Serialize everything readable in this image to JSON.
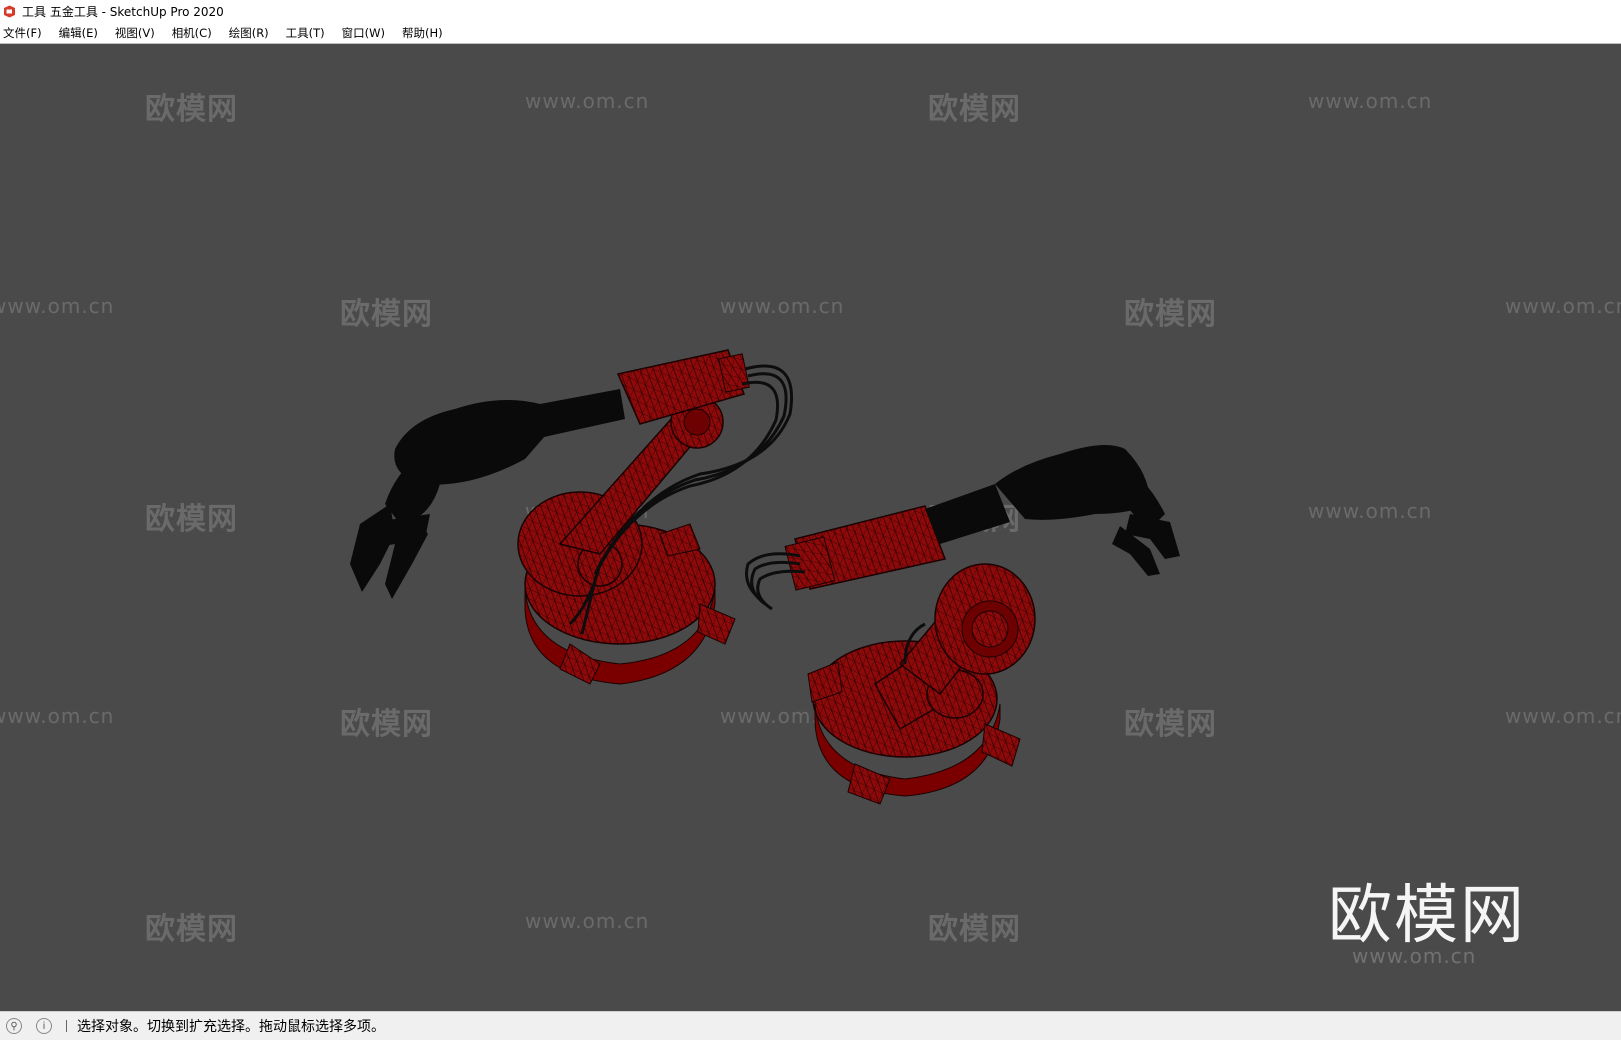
{
  "window": {
    "title": "工具 五金工具 - SketchUp Pro 2020",
    "icon": "sketchup-icon"
  },
  "menubar": {
    "items": [
      {
        "label": "文件(F)"
      },
      {
        "label": "编辑(E)"
      },
      {
        "label": "视图(V)"
      },
      {
        "label": "相机(C)"
      },
      {
        "label": "绘图(R)"
      },
      {
        "label": "工具(T)"
      },
      {
        "label": "窗口(W)"
      },
      {
        "label": "帮助(H)"
      }
    ]
  },
  "viewport": {
    "background": "#4a4a4a",
    "model_color": "#8b0000",
    "model_dark": "#0a0a0a",
    "watermark_logo": "欧模网",
    "watermark_url": "www.om.cn",
    "big_watermark": "欧模网"
  },
  "statusbar": {
    "icons": [
      "geo-location-icon",
      "info-icon"
    ],
    "message": "选择对象。切换到扩充选择。拖动鼠标选择多项。"
  }
}
